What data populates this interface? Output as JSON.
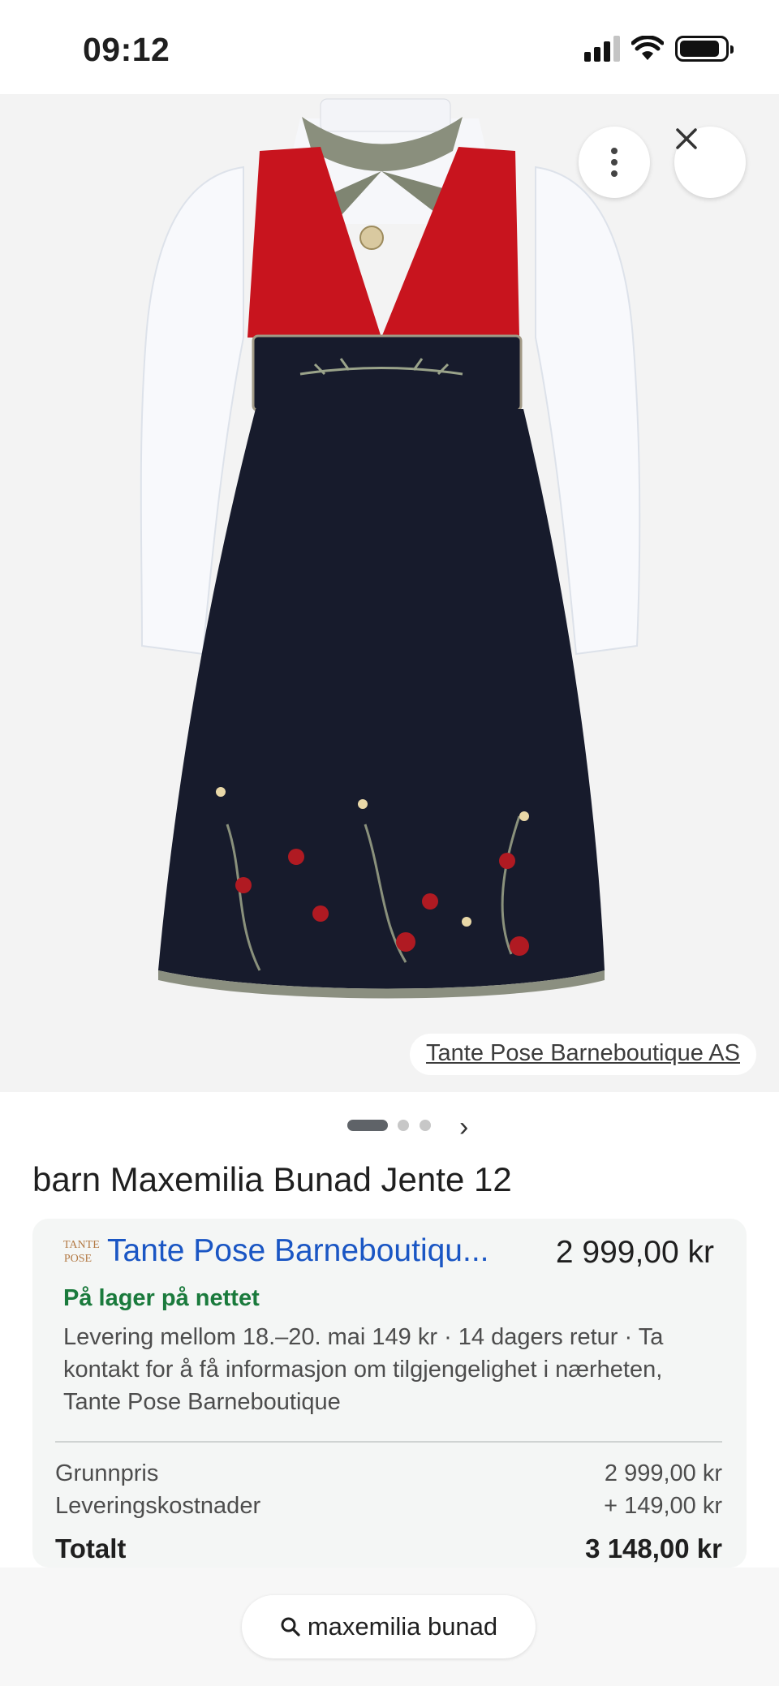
{
  "status_bar": {
    "time": "09:12"
  },
  "hero": {
    "source_label": "Tante Pose Barneboutique AS",
    "more_icon": "more-vert-icon",
    "close_icon": "close-icon"
  },
  "pager": {
    "total_pages": 3,
    "current_page": 1,
    "next_icon": "chevron-right-icon"
  },
  "product": {
    "title": "barn Maxemilia Bunad Jente 12"
  },
  "offer": {
    "merchant_logo_text": "TANTE POSE",
    "merchant_name": "Tante Pose Barneboutiqu...",
    "price": "2 999,00 kr",
    "stock_status": "På lager på nettet",
    "delivery_info": "Levering mellom 18.–20. mai 149 kr · 14 dagers retur · Ta kontakt for å få informasjon om tilgjengelighet i nærheten, Tante Pose Barneboutique",
    "base_price_label": "Grunnpris",
    "base_price_value": "2 999,00 kr",
    "shipping_label": "Leveringskostnader",
    "shipping_value": "+ 149,00 kr",
    "total_label": "Totalt",
    "total_value": "3 148,00 kr"
  },
  "search": {
    "query": "maxemilia bunad",
    "icon": "search-icon"
  },
  "colors": {
    "link_blue": "#1a56c4",
    "stock_green": "#1a7a3c",
    "bodice_red": "#c8141e",
    "skirt_navy": "#171b2c"
  }
}
